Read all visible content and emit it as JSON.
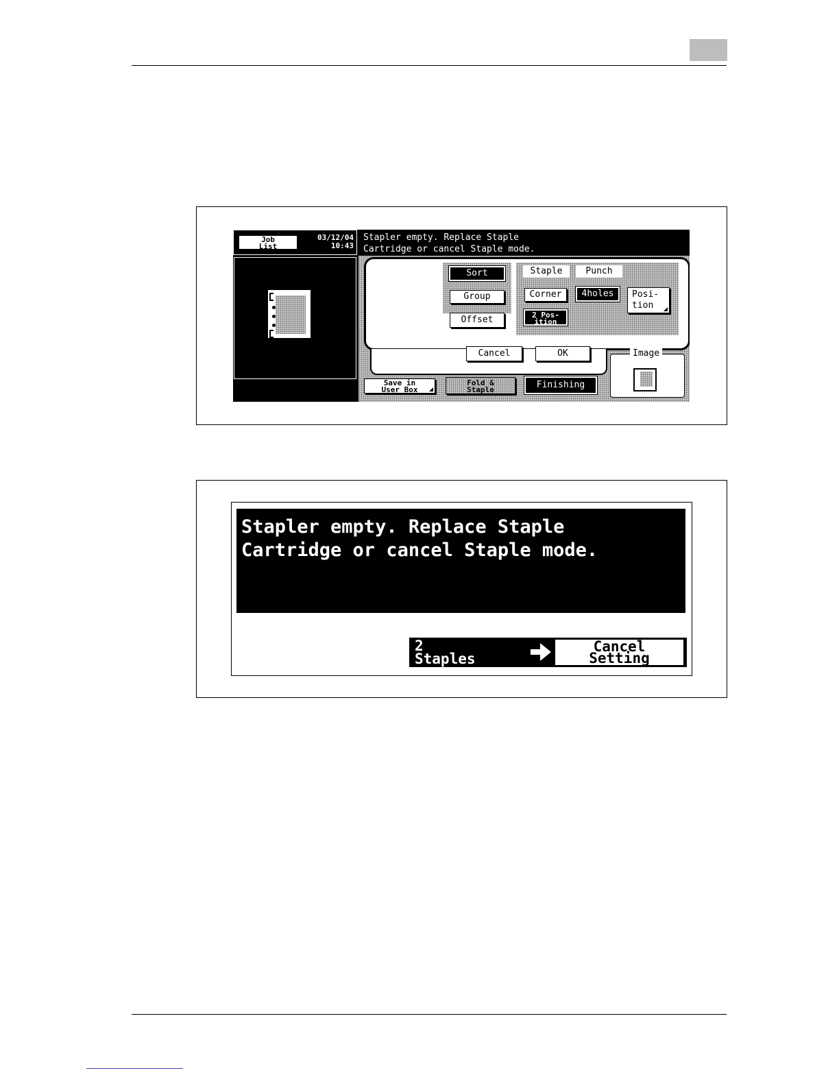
{
  "page": {
    "chapter_tab": ""
  },
  "screen1": {
    "job_list_label": "Job\nList",
    "date": "03/12/04",
    "time": "10:43",
    "message": "Stapler empty. Replace Staple\nCartridge or cancel Staple mode.",
    "sort_label": "Sort",
    "group_label": "Group",
    "offset_label": "Offset",
    "staple_label": "Staple",
    "punch_label": "Punch",
    "corner_label": "Corner",
    "holes_label": "4holes",
    "two_position_label": "2 Pos-\nition",
    "position_label": "Posi-\ntion",
    "cancel_label": "Cancel",
    "ok_label": "OK",
    "image_label": "Image",
    "save_user_box_label": "Save in\nUser Box",
    "fold_staple_label": "Fold &\nStaple",
    "finishing_label": "Finishing"
  },
  "screen2": {
    "message": "Stapler empty. Replace Staple\nCartridge or cancel Staple mode.",
    "staples_label": "2\nStaples",
    "arrow_icon": "right-arrow-icon",
    "cancel_setting_label": "Cancel\nSetting"
  }
}
